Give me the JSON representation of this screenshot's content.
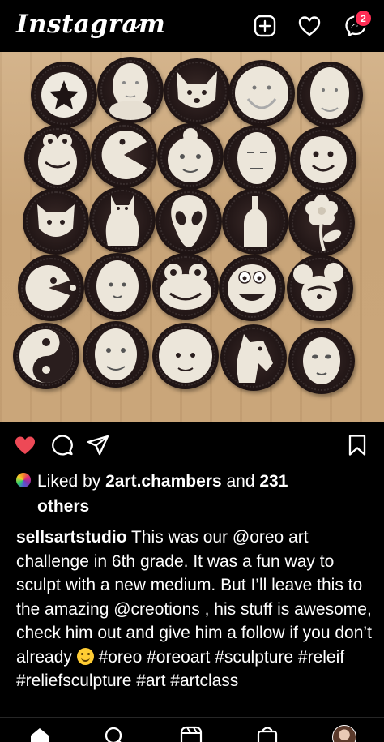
{
  "header": {
    "app_title": "Instagram",
    "icons": [
      "new-post-icon",
      "heart-icon",
      "messenger-icon"
    ],
    "messages_badge": "2"
  },
  "post": {
    "image_subject": "grid of Oreo cookie relief sculptures",
    "likes": {
      "prefix": "Liked by",
      "user": "2art.chambers",
      "connector": "and",
      "count": "231",
      "suffix": "others"
    },
    "caption": {
      "username": "sellsartstudio",
      "text": "This was our @oreo art challenge in 6th grade. It was a fun way to sculpt with a new medium. But I’ll leave this to the amazing @creotions , his stuff is awesome, check him out and give him a follow if you don’t already",
      "hashtags": "#oreo #oreoart #sculpture #releif #reliefsculpture #art #artclass"
    }
  },
  "colors": {
    "background": "#000000",
    "like_active": "#ed4956",
    "badge": "#ff2d55",
    "wood": "#c9a579"
  },
  "bottom_nav": {
    "icons": [
      "home-icon",
      "search-icon",
      "reels-icon",
      "shop-icon",
      "profile-avatar"
    ]
  }
}
